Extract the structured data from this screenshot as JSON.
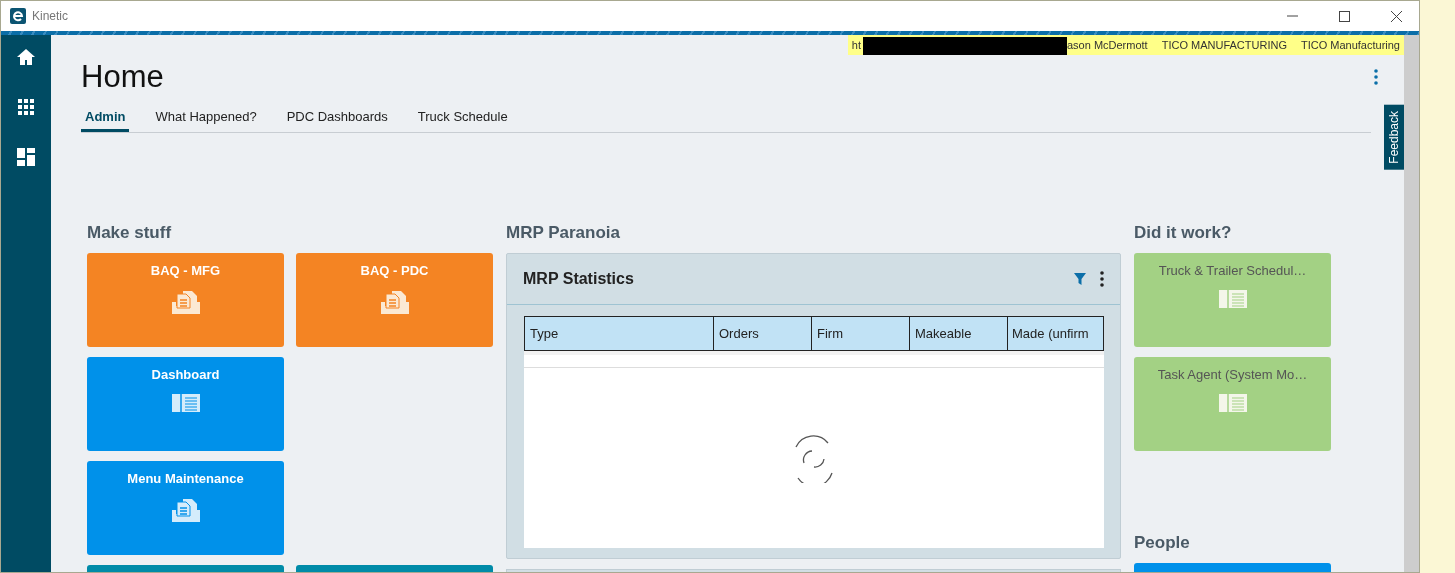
{
  "window": {
    "title": "Kinetic"
  },
  "sidebar": {
    "items": [
      {
        "kind": "home"
      },
      {
        "kind": "apps"
      },
      {
        "kind": "dashboard"
      }
    ]
  },
  "user_bar": {
    "items": [
      "ht",
      "ason McDermott",
      "TICO MANUFACTURING",
      "TICO Manufacturing"
    ]
  },
  "page": {
    "title": "Home"
  },
  "tabs": [
    {
      "label": "Admin",
      "selected": true
    },
    {
      "label": "What Happened?",
      "selected": false
    },
    {
      "label": "PDC Dashboards",
      "selected": false
    },
    {
      "label": "Truck Schedule",
      "selected": false
    }
  ],
  "feedback": {
    "label": "Feedback"
  },
  "sections": [
    {
      "title": "Make stuff",
      "kind": "tiles",
      "rows": [
        [
          {
            "title": "BAQ - MFG",
            "kind": "report",
            "color": "#f48423"
          },
          {
            "title": "BAQ - PDC",
            "kind": "report",
            "color": "#f48423"
          }
        ],
        [
          {
            "title": "Dashboard",
            "kind": "dashboard",
            "color": "#0091ea"
          }
        ],
        [
          {
            "title": "Menu Maintenance",
            "kind": "report",
            "color": "#0091ea"
          }
        ],
        [
          {
            "kind": "blank",
            "color": "#008ba8"
          },
          {
            "kind": "blank",
            "color": "#008ba8"
          }
        ]
      ]
    },
    {
      "title": "MRP Paranoia",
      "kind": "panel",
      "panel": {
        "title": "MRP Statistics",
        "columns": [
          "Type",
          "Orders",
          "Firm",
          "Makeable",
          "Made (unfirm"
        ]
      }
    },
    {
      "title": "Did it work?",
      "kind": "tiles",
      "rows": [
        [
          {
            "title": "Truck & Trailer Schedul…",
            "kind": "dashboard",
            "color": "#a3d184"
          }
        ],
        [
          {
            "title": "Task Agent (System Mo…",
            "kind": "dashboard",
            "color": "#a3d184"
          }
        ]
      ]
    },
    {
      "title": "People",
      "kind": "tiles",
      "rows": [
        [
          {
            "kind": "blank",
            "color": "#0091ea"
          }
        ]
      ]
    }
  ]
}
